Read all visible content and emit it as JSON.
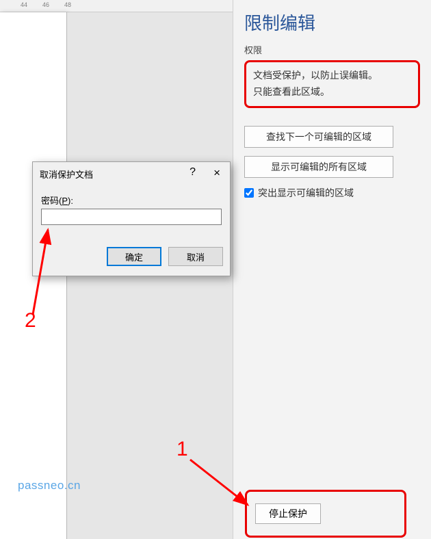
{
  "ruler": {
    "t44": "44",
    "t46": "46",
    "t48": "48"
  },
  "panel": {
    "title": "限制编辑",
    "permissions_label": "权限",
    "info_line1": "文档受保护，以防止误编辑。",
    "info_line2": "只能查看此区域。",
    "btn_find_next": "查找下一个可编辑的区域",
    "btn_show_all": "显示可编辑的所有区域",
    "checkbox_label": "突出显示可编辑的区域",
    "checkbox_checked": true,
    "stop_protect": "停止保护"
  },
  "dialog": {
    "title": "取消保护文档",
    "help": "?",
    "close": "×",
    "password_label_pre": "密码(",
    "password_label_u": "P",
    "password_label_post": "):",
    "password_value": "",
    "ok": "确定",
    "cancel": "取消"
  },
  "annotations": {
    "one": "1",
    "two": "2",
    "watermark": "passneo.cn"
  }
}
